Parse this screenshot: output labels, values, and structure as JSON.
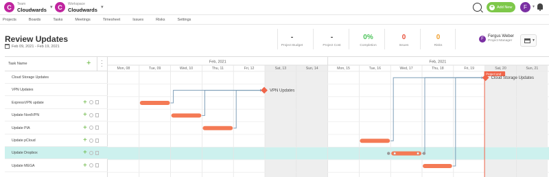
{
  "header": {
    "team": {
      "small": "Team",
      "name": "Cloudwards",
      "initial": "C"
    },
    "workspace": {
      "small": "Workspace",
      "name": "Cloudwards",
      "initial": "C"
    },
    "add_new": "Add New",
    "user_initial": "F"
  },
  "nav": [
    "Projects",
    "Boards",
    "Tasks",
    "Meetings",
    "Timesheet",
    "Issues",
    "Risks",
    "Settings"
  ],
  "page": {
    "title": "Review Updates",
    "date_range": "Feb 09, 2021 - Feb 19, 2021"
  },
  "stats": [
    {
      "value": "-",
      "label": "Project Budget",
      "color": "#333333"
    },
    {
      "value": "-",
      "label": "Project Cost",
      "color": "#333333"
    },
    {
      "value": "0%",
      "label": "Completion",
      "color": "#4cc35a"
    },
    {
      "value": "0",
      "label": "Issues",
      "color": "#e8503a"
    },
    {
      "value": "0",
      "label": "Risks",
      "color": "#f0a030"
    }
  ],
  "owner": {
    "name": "Fergus Weber",
    "role": "Project Manager",
    "initial": "F"
  },
  "gantt": {
    "task_header": "Task Name",
    "months": [
      "Feb, 2021",
      "Feb, 2021"
    ],
    "days": [
      "Mon, 08",
      "Tue, 09",
      "Wed, 10",
      "Thu, 11",
      "Fri, 12",
      "Sat, 13",
      "Sun, 14",
      "Mon, 15",
      "Tue, 16",
      "Wed, 17",
      "Thu, 18",
      "Fri, 19",
      "Sat, 20",
      "Sun, 21"
    ],
    "weekend_days": [
      5,
      6,
      12,
      13
    ],
    "today_label": "Project end",
    "tasks": [
      {
        "name": "Cloud Storage Updates",
        "actions": false
      },
      {
        "name": "VPN Updates",
        "actions": false
      },
      {
        "name": "ExpressVPN update",
        "actions": true
      },
      {
        "name": "Update NordVPN",
        "actions": true
      },
      {
        "name": "Update PIA",
        "actions": true
      },
      {
        "name": "Update pCloud",
        "actions": true
      },
      {
        "name": "Update Dropbox",
        "actions": true,
        "selected": true
      },
      {
        "name": "Update MEGA",
        "actions": true
      }
    ],
    "milestones": [
      {
        "label": "VPN Updates"
      },
      {
        "label": "Cloud Storage Updates"
      }
    ],
    "colors": {
      "bar": "#f47a55",
      "milestone": "#f0654a",
      "link": "#7f9fb8",
      "today": "#f0654a",
      "selected_row": "#cdf1ee",
      "weekend": "#eeeeee"
    }
  }
}
